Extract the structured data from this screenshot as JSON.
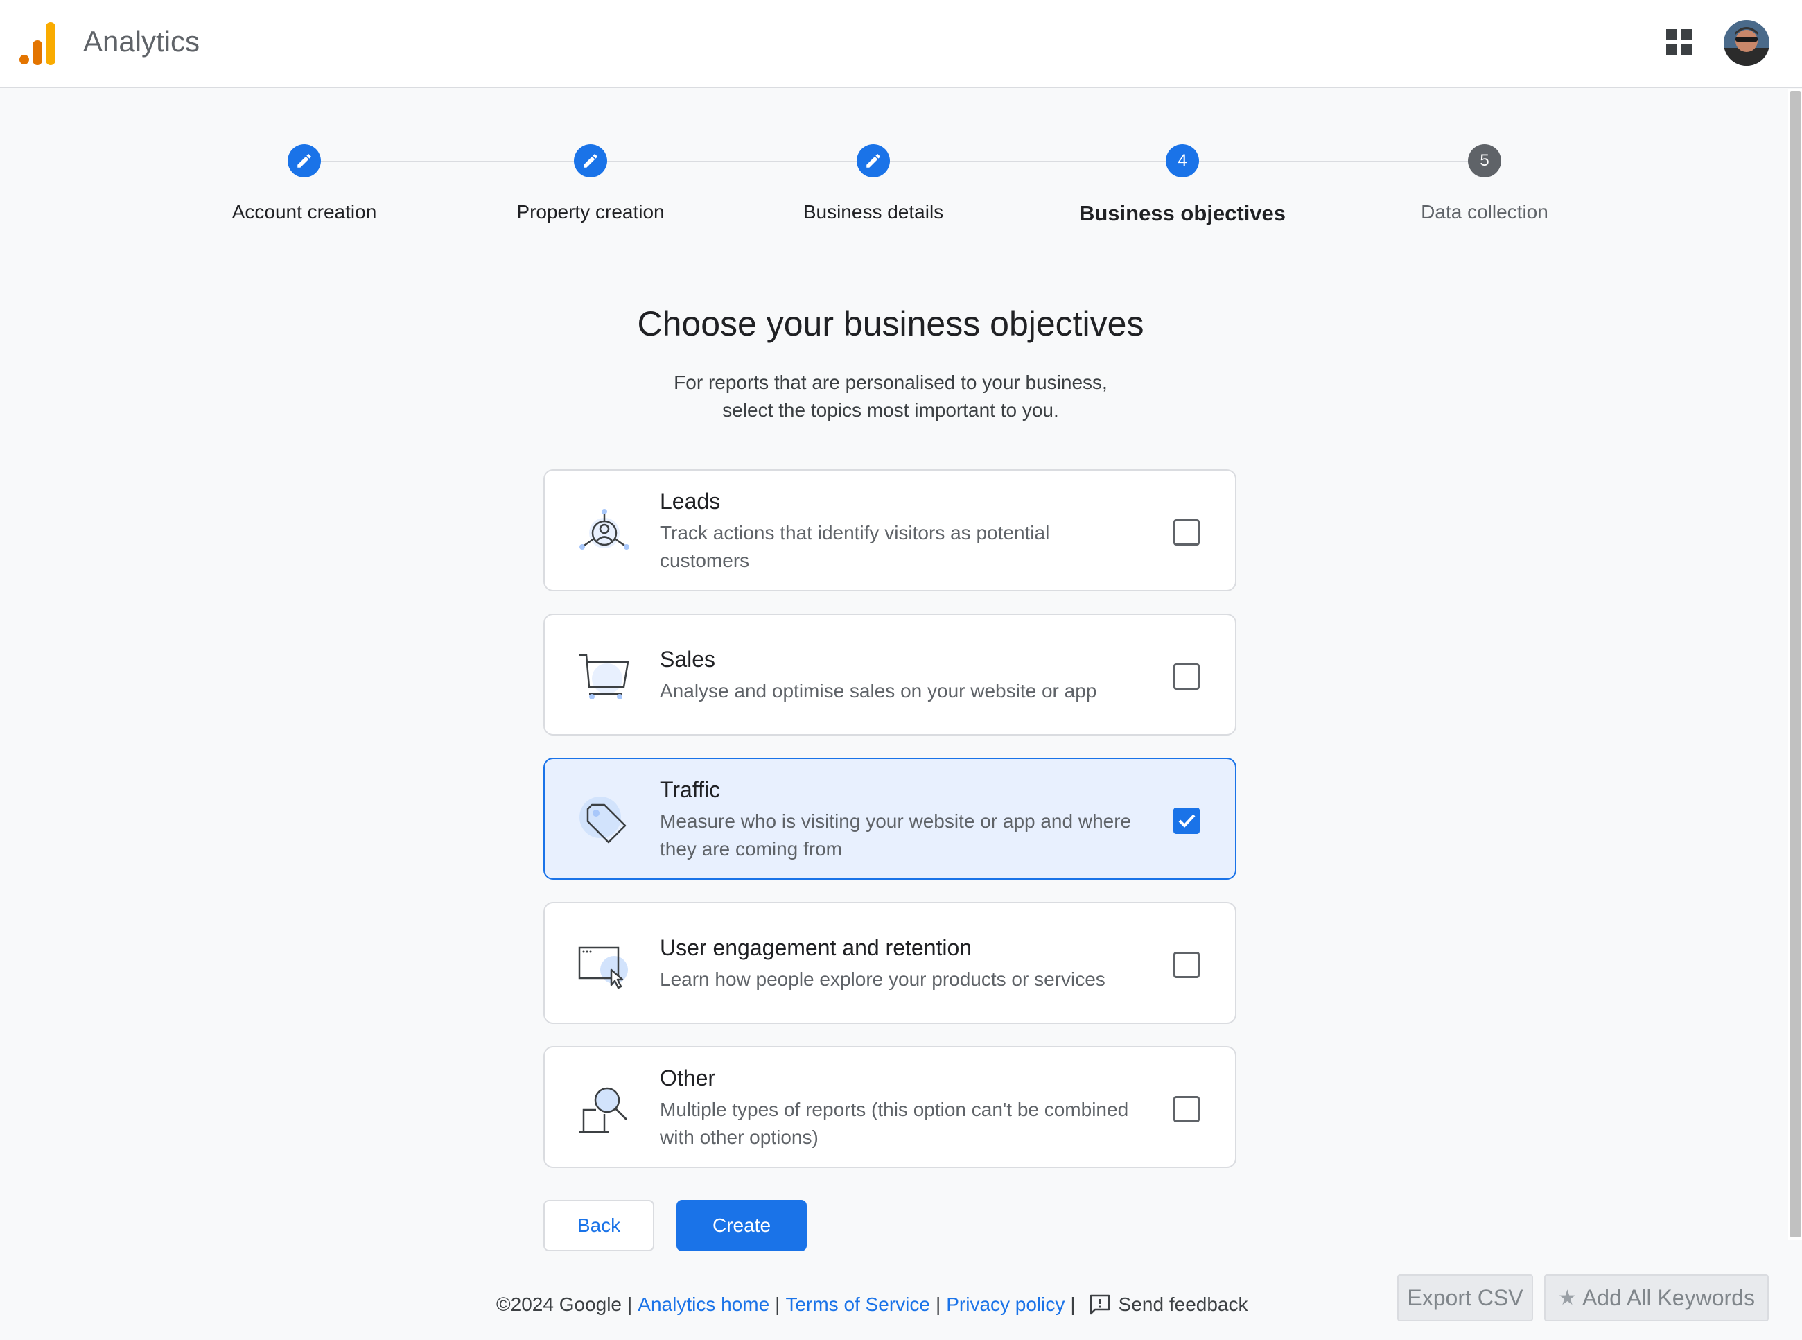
{
  "header": {
    "app_title": "Analytics",
    "logo_icon": "analytics-bar-logo",
    "apps_icon": "grid-apps-icon",
    "avatar_icon": "user-avatar"
  },
  "stepper": {
    "steps": [
      {
        "label": "Account creation",
        "state": "done",
        "marker": ""
      },
      {
        "label": "Property creation",
        "state": "done",
        "marker": ""
      },
      {
        "label": "Business details",
        "state": "done",
        "marker": ""
      },
      {
        "label": "Business objectives",
        "state": "active",
        "marker": "4"
      },
      {
        "label": "Data collection",
        "state": "future",
        "marker": "5"
      }
    ]
  },
  "main": {
    "heading": "Choose your business objectives",
    "subtitle_line1": "For reports that are personalised to your business,",
    "subtitle_line2": "select the topics most important to you."
  },
  "objectives": [
    {
      "title": "Leads",
      "desc_line1": "Track actions that identify visitors as potential",
      "desc_line2": "customers",
      "checked": false,
      "icon": "leads-target-icon"
    },
    {
      "title": "Sales",
      "desc_line1": "Analyse and optimise sales on your website or app",
      "desc_line2": "",
      "checked": false,
      "icon": "shopping-cart-icon"
    },
    {
      "title": "Traffic",
      "desc_line1": "Measure who is visiting your website or app and where",
      "desc_line2": "they are coming from",
      "checked": true,
      "icon": "tag-icon"
    },
    {
      "title": "User engagement and retention",
      "desc_line1": "Learn how people explore your products or services",
      "desc_line2": "",
      "checked": false,
      "icon": "window-cursor-icon"
    },
    {
      "title": "Other",
      "desc_line1": "Multiple types of reports (this option can't be combined",
      "desc_line2": "with other options)",
      "checked": false,
      "icon": "magnifier-icon"
    }
  ],
  "actions": {
    "back_label": "Back",
    "create_label": "Create"
  },
  "footer": {
    "copyright": "©2024 Google",
    "analytics_home": "Analytics home",
    "terms": "Terms of Service",
    "privacy": "Privacy policy",
    "feedback": "Send feedback",
    "separator": "|"
  },
  "extension": {
    "export_csv": "Export CSV",
    "add_keywords": "Add All Keywords",
    "star_glyph": "★"
  },
  "colors": {
    "accent": "#1a73e8",
    "selected_bg": "#e8f0fe",
    "future_step": "#5f6368"
  }
}
